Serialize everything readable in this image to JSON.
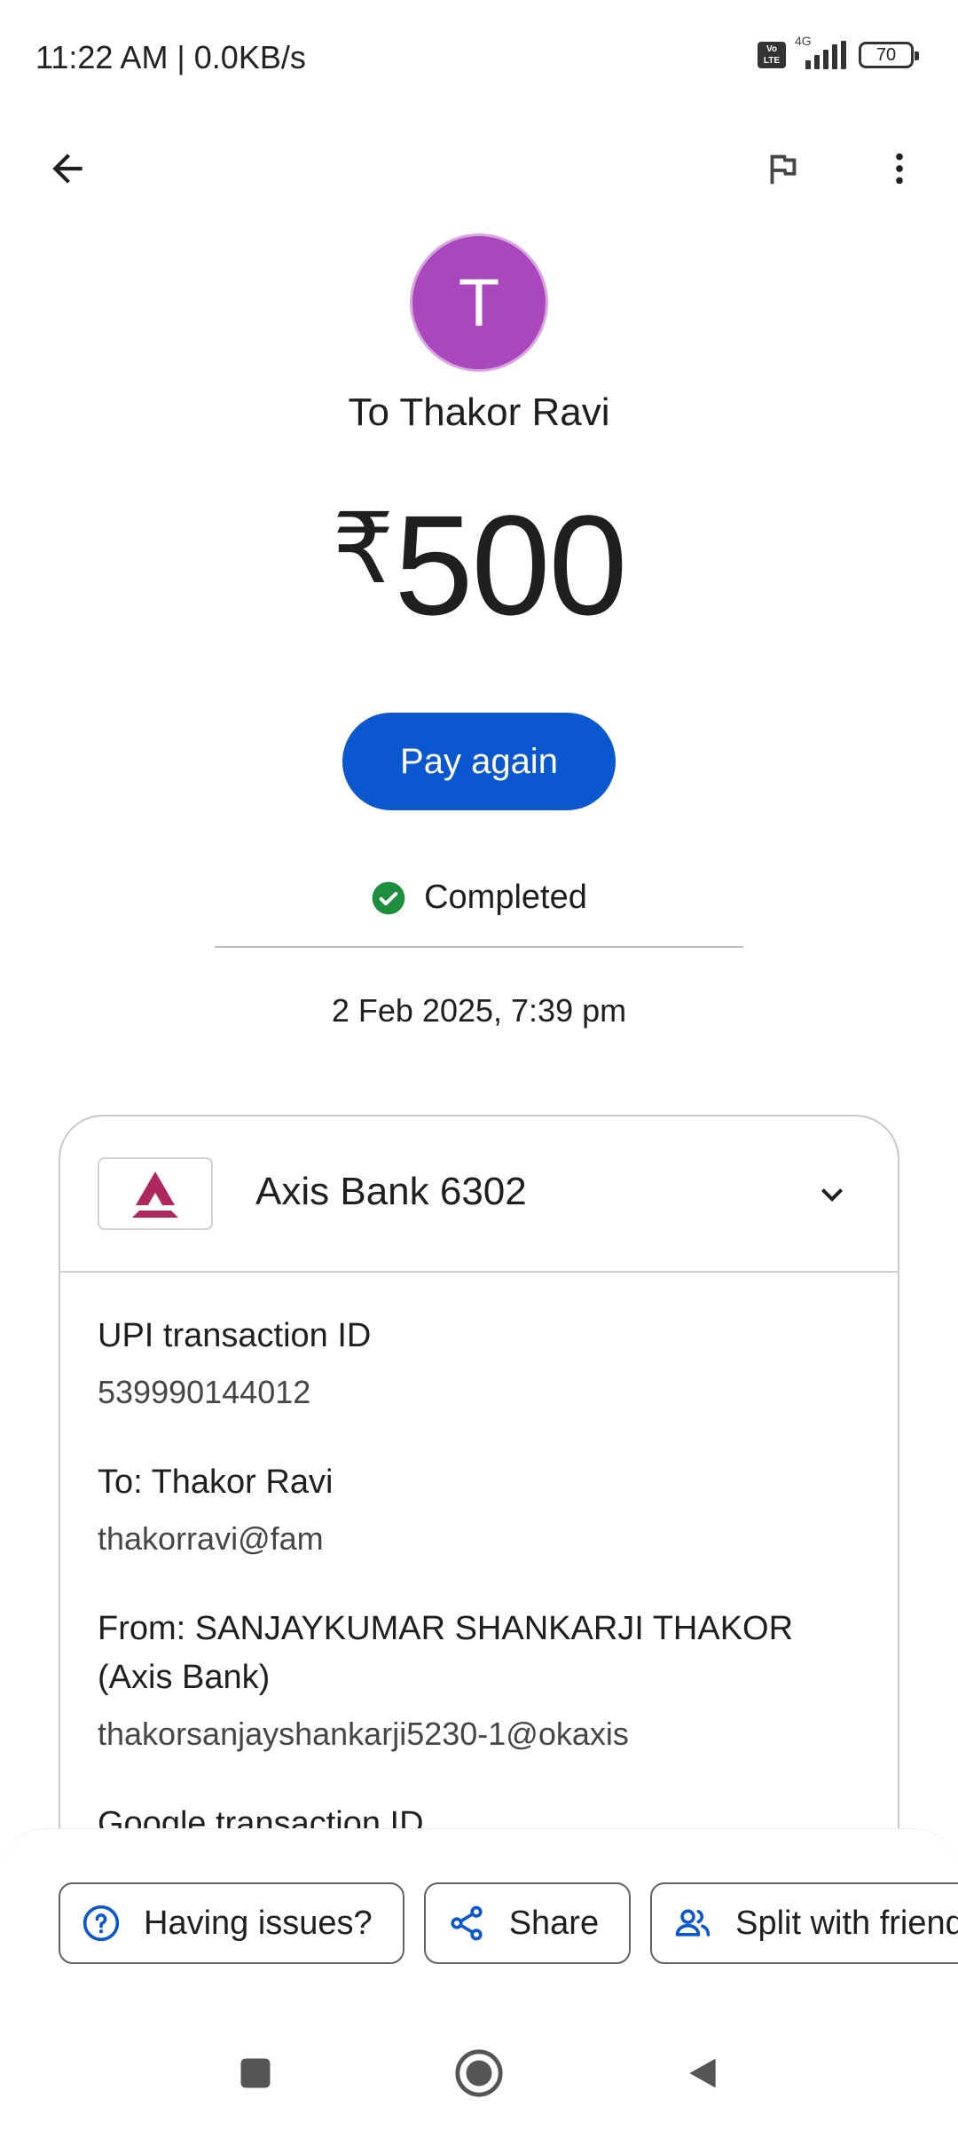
{
  "status_bar": {
    "time": "11:22 AM | 0.0KB/s",
    "volte_top": "Vo",
    "volte_bottom": "LTE",
    "network": "4G",
    "battery": "70"
  },
  "app_bar": {
    "back_icon": "arrow-back-icon",
    "flag_icon": "flag-icon",
    "more_icon": "more-vert-icon"
  },
  "header": {
    "avatar_initial": "T",
    "avatar_color": "#ab47bc",
    "title": "To Thakor Ravi",
    "currency_symbol": "₹",
    "amount": "500",
    "pay_again_label": "Pay again",
    "status": "Completed",
    "status_color": "#1e8e3e",
    "datetime": "2 Feb 2025, 7:39 pm"
  },
  "card": {
    "bank_name": "Axis Bank 6302",
    "bank_logo_color": "#ae275f",
    "details": [
      {
        "label": "UPI transaction ID",
        "value": "539990144012"
      },
      {
        "label": "To: Thakor Ravi",
        "value": "thakorravi@fam"
      },
      {
        "label": "From: SANJAYKUMAR SHANKARJI THAKOR (Axis Bank)",
        "value": "thakorsanjayshankarji5230-1@okaxis"
      },
      {
        "label": "Google transaction ID",
        "value": ""
      }
    ]
  },
  "actions": {
    "having_issues": "Having issues?",
    "share": "Share",
    "split": "Split with friends",
    "accent": "#0b57d0"
  }
}
